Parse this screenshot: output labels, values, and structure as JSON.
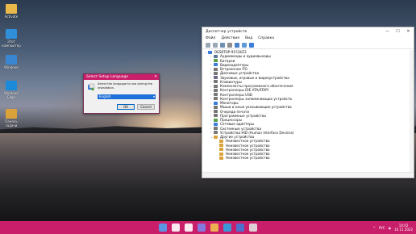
{
  "desktop": {
    "icons": [
      {
        "label": "Activate",
        "icon": "folder-icon",
        "color": "#e8b84a"
      },
      {
        "label": "Этот компьютер",
        "icon": "computer-icon",
        "color": "#2f8fd9"
      },
      {
        "label": "Windows",
        "icon": "settings-icon",
        "color": "#3a86d1"
      },
      {
        "label": "Windows Edge",
        "icon": "edge-icon",
        "color": "#1b8ad8"
      },
      {
        "label": "Панель задачи",
        "icon": "folder-icon",
        "color": "#d9a23a"
      }
    ]
  },
  "device_manager": {
    "title": "Диспетчер устройств",
    "controls": [
      "—",
      "☐",
      "✕"
    ],
    "menu": [
      "Файл",
      "Действие",
      "Вид",
      "Справка"
    ],
    "tree": [
      {
        "label": "DESKTOP-9151KZ3",
        "level": 0,
        "expanded": true,
        "color": "#3b7dd8"
      },
      {
        "label": "Аудиовходы и аудиовыходы",
        "level": 1,
        "color": "#5a7a99"
      },
      {
        "label": "Батареи",
        "level": 1,
        "color": "#5aa04a"
      },
      {
        "label": "Видеоадаптеры",
        "level": 1,
        "color": "#3b7dd8"
      },
      {
        "label": "Встроенное ПО",
        "level": 1,
        "color": "#777777"
      },
      {
        "label": "Дисковые устройства",
        "level": 1,
        "color": "#777777"
      },
      {
        "label": "Звуковые, игровые и видеоустройства",
        "level": 1,
        "color": "#6a6a8a"
      },
      {
        "label": "Клавиатуры",
        "level": 1,
        "color": "#777777"
      },
      {
        "label": "Компоненты программного обеспечения",
        "level": 1,
        "color": "#777777"
      },
      {
        "label": "Контроллеры IDE ATA/ATAPI",
        "level": 1,
        "color": "#777777"
      },
      {
        "label": "Контроллеры USB",
        "level": 1,
        "color": "#777777"
      },
      {
        "label": "Контроллеры запоминающих устройств",
        "level": 1,
        "color": "#777777"
      },
      {
        "label": "Мониторы",
        "level": 1,
        "color": "#3b7dd8"
      },
      {
        "label": "Мыши и иные указывающие устройства",
        "level": 1,
        "color": "#777777"
      },
      {
        "label": "Очереди печати",
        "level": 1,
        "color": "#777777"
      },
      {
        "label": "Программные устройства",
        "level": 1,
        "color": "#777777"
      },
      {
        "label": "Процессоры",
        "level": 1,
        "color": "#5aa04a"
      },
      {
        "label": "Сетевые адаптеры",
        "level": 1,
        "color": "#3b7dd8"
      },
      {
        "label": "Системные устройства",
        "level": 1,
        "color": "#777777"
      },
      {
        "label": "Устройства HID (Human Interface Devices)",
        "level": 1,
        "color": "#777777"
      },
      {
        "label": "Другие устройства",
        "level": 1,
        "expanded": true,
        "color": "#d9a23a"
      },
      {
        "label": "Неизвестное устройство",
        "level": 2,
        "color": "#d9a23a"
      },
      {
        "label": "Неизвестное устройство",
        "level": 2,
        "color": "#d9a23a"
      },
      {
        "label": "Неизвестное устройство",
        "level": 2,
        "color": "#d9a23a"
      },
      {
        "label": "Неизвестное устройство",
        "level": 2,
        "color": "#d9a23a"
      },
      {
        "label": "Неизвестное устройство",
        "level": 2,
        "color": "#d9a23a"
      }
    ]
  },
  "language_dialog": {
    "title": "Select Setup Language",
    "message": "Select the language to use during the installation.",
    "selected": "English",
    "ok_label": "OK",
    "cancel_label": "Cancel"
  },
  "taskbar": {
    "color": "#c91f6b",
    "apps": [
      {
        "icon": "start-icon",
        "color": "#4ea3f2"
      },
      {
        "icon": "search-icon",
        "color": "#ffffff"
      },
      {
        "icon": "task-view-icon",
        "color": "#ffffff"
      },
      {
        "icon": "chat-icon",
        "color": "#7b83eb"
      },
      {
        "icon": "explorer-icon",
        "color": "#f2c14e"
      },
      {
        "icon": "edge-icon",
        "color": "#2aa5e6"
      },
      {
        "icon": "store-icon",
        "color": "#3f7ad9"
      },
      {
        "icon": "setup-icon",
        "color": "#e2e2e2"
      }
    ],
    "tray": {
      "chevron": "^",
      "language": "РУС",
      "time": "10:02",
      "date": "10.11.2022"
    }
  }
}
